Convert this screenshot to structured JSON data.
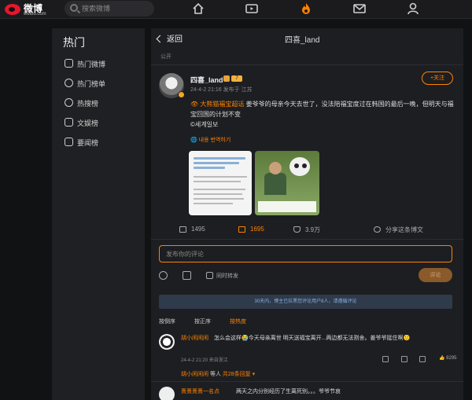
{
  "topbar": {
    "brand": "微博",
    "brand_sub": "weibo.com",
    "search_placeholder": "搜索微博",
    "nav_icons": [
      "home-icon",
      "video-icon",
      "hot-fire-icon",
      "message-icon",
      "profile-icon"
    ],
    "active_nav": "hot-fire-icon"
  },
  "sidebar": {
    "title": "热门",
    "items": [
      {
        "label": "热门微博",
        "icon": "fire-icon"
      },
      {
        "label": "热门榜单",
        "icon": "clock-icon"
      },
      {
        "label": "热搜榜",
        "icon": "search-rank-icon"
      },
      {
        "label": "文娱榜",
        "icon": "entertainment-icon"
      },
      {
        "label": "要闻榜",
        "icon": "news-icon"
      }
    ]
  },
  "post_header": {
    "back_label": "返回",
    "title": "四喜_land"
  },
  "post": {
    "visibility": "公开",
    "author": "四喜_land",
    "level_badge": "7",
    "meta": "24-4-2 21:16 发布于 江苏",
    "follow_label": "+关注",
    "topic": "大熊猫福宝超话",
    "text": "姜爷爷的母亲今天去世了，没法陪福宝度过在韩国的最后一晚，但明天与福宝回国的计划不变",
    "source": "©세계일보",
    "translate": "내용 번역하기",
    "image_left_caption": "",
    "image_right_caption": ""
  },
  "actions": {
    "repost_count": "1495",
    "comment_count": "1695",
    "like_count": "3.9万",
    "share_label": "分享这条博文"
  },
  "comment_form": {
    "placeholder": "发布你的评论",
    "repost_checkbox_label": "同时转发",
    "submit_label": "评论"
  },
  "notice": "30天内，博主已拉黑您评论用户8人，请遵循评论",
  "sort": [
    "按热度",
    "按正序",
    "按热度"
  ],
  "sort_labels": {
    "a": "按倒序",
    "b": "按正序",
    "c": "按热度"
  },
  "comments": [
    {
      "name": "胡小闲闲闲",
      "text": "怎么会这样😭今天母亲离世 明天送福宝离开...两边都无法割舍。姜爷爷挺住啊🙂",
      "meta": "24-4-2 21:20 来自浙江",
      "likes": "8295",
      "reply_name": "胡小闲闲闲",
      "reply_more": "等人",
      "reply_total": "共28条回复"
    },
    {
      "name": "熹熹熹熹一名点",
      "text": "两天之内分别经历了生离死别。。。爷爷节哀"
    }
  ],
  "colors": {
    "accent": "#ff8200",
    "background": "#111214",
    "panel": "#1d1e21"
  }
}
